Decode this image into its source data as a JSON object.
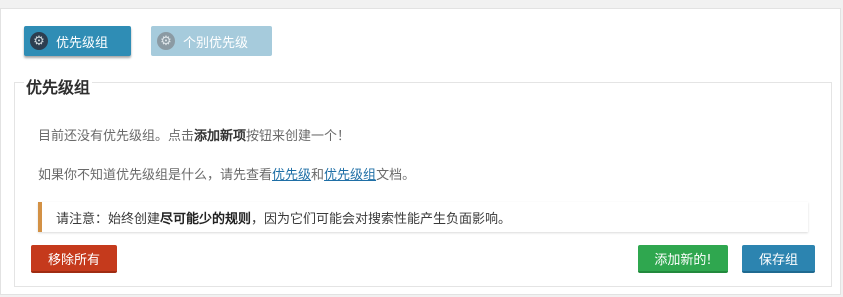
{
  "tabs": [
    {
      "label": "优先级组",
      "icon": "gear-icon",
      "active": true
    },
    {
      "label": "个别优先级",
      "icon": "gear-icon",
      "active": false
    }
  ],
  "panel": {
    "title": "优先级组",
    "empty_text_prefix": "目前还没有优先级组。点击",
    "empty_text_bold": "添加新项",
    "empty_text_suffix": "按钮来创建一个！",
    "help_text_prefix": "如果你不知道优先级组是什么，请先查看",
    "help_link_1": "优先级",
    "help_text_mid": "和",
    "help_link_2": "优先级组",
    "help_text_suffix": "文档。",
    "notice_prefix": "请注意：始终创建",
    "notice_bold": "尽可能少的规则",
    "notice_suffix": "，因为它们可能会对搜索性能产生负面影响。"
  },
  "buttons": {
    "remove_all": "移除所有",
    "add_new": "添加新的!",
    "save_group": "保存组"
  },
  "colors": {
    "primary": "#2f8db5",
    "danger": "#c53a1c",
    "success": "#2fa74f",
    "notice_accent": "#d39145"
  }
}
